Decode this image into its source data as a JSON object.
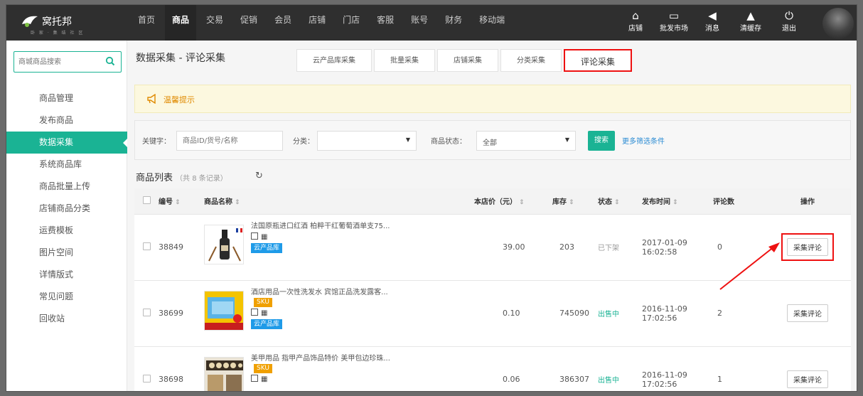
{
  "logo": {
    "name": "窝托邦",
    "sub": "卧 家 · 集 结 社 区"
  },
  "nav": [
    "首页",
    "商品",
    "交易",
    "促销",
    "会员",
    "店铺",
    "门店",
    "客服",
    "账号",
    "财务",
    "移动端"
  ],
  "nav_active": "商品",
  "tools": [
    {
      "icon": "home-icon",
      "label": "店铺"
    },
    {
      "icon": "monitor-icon",
      "label": "批发市场"
    },
    {
      "icon": "bell-icon",
      "label": "消息"
    },
    {
      "icon": "broom-icon",
      "label": "清缓存"
    },
    {
      "icon": "power-icon",
      "label": "退出"
    }
  ],
  "sidebar": {
    "search_placeholder": "商城商品搜索",
    "items": [
      "商品管理",
      "发布商品",
      "数据采集",
      "系统商品库",
      "商品批量上传",
      "店铺商品分类",
      "运费模板",
      "图片空间",
      "详情版式",
      "常见问题",
      "回收站"
    ],
    "active": "数据采集"
  },
  "page": {
    "title": "数据采集 - 评论采集",
    "tabs": [
      "云产品库采集",
      "批量采集",
      "店铺采集",
      "分类采集",
      "评论采集"
    ],
    "active_tab": "评论采集",
    "notice": "温馨提示"
  },
  "filter": {
    "keyword_label": "关键字：",
    "keyword_placeholder": "商品ID/货号/名称",
    "category_label": "分类：",
    "category_value": "",
    "status_label": "商品状态：",
    "status_value": "全部",
    "search_button": "搜索",
    "more_link": "更多筛选条件"
  },
  "list": {
    "title": "商品列表",
    "count": "（共 8 条记录）",
    "columns": [
      "编号",
      "商品名称",
      "本店价（元）",
      "库存",
      "状态",
      "发布时间",
      "评论数",
      "操作"
    ],
    "rows": [
      {
        "id": "38849",
        "name": "法国原瓶进口红酒 柏粹干红葡萄酒单支75...",
        "sku": "",
        "tag": "云产品库",
        "price": "39.00",
        "stock": "203",
        "status": "已下架",
        "status_type": "off",
        "date": "2017-01-09",
        "time": "16:02:58",
        "comments": "0",
        "action": "采集评论",
        "highlight": true
      },
      {
        "id": "38699",
        "name": "酒店用品一次性洗发水 宾馆正品洗发露客...",
        "sku": "SKU",
        "tag": "云产品库",
        "price": "0.10",
        "stock": "745090",
        "status": "出售中",
        "status_type": "on",
        "date": "2016-11-09",
        "time": "17:02:56",
        "comments": "2",
        "action": "采集评论",
        "highlight": false
      },
      {
        "id": "38698",
        "name": "美甲用品 指甲产品饰品特价 美甲包边珍珠...",
        "sku": "SKU",
        "tag": "",
        "price": "0.06",
        "stock": "386307",
        "status": "出售中",
        "status_type": "on",
        "date": "2016-11-09",
        "time": "17:02:56",
        "comments": "1",
        "action": "采集评论",
        "highlight": false
      }
    ]
  },
  "colors": {
    "accent": "#1ab394",
    "highlight": "#ee1111",
    "nav_bg": "#2f2f2f",
    "notice_text": "#e08a00",
    "link": "#2a8bd3"
  }
}
